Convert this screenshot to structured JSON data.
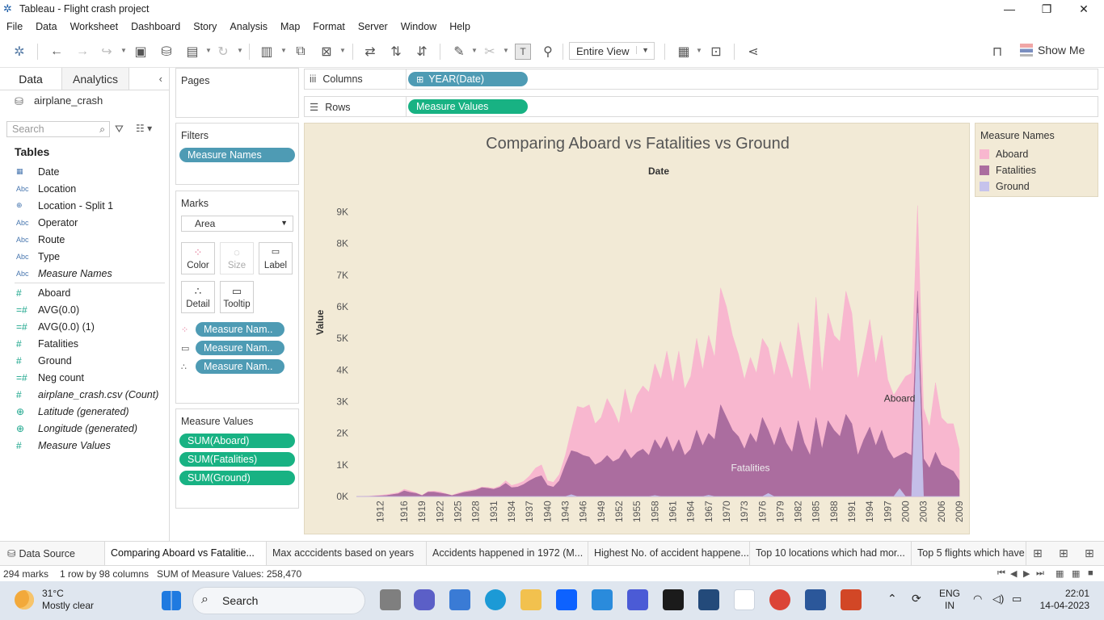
{
  "window": {
    "title": "Tableau - Flight crash project"
  },
  "menu": [
    "File",
    "Data",
    "Worksheet",
    "Dashboard",
    "Story",
    "Analysis",
    "Map",
    "Format",
    "Server",
    "Window",
    "Help"
  ],
  "toolbar": {
    "view_select": "Entire View",
    "show_me": "Show Me"
  },
  "data_pane": {
    "tab_data": "Data",
    "tab_analytics": "Analytics",
    "datasource": "airplane_crash",
    "search_placeholder": "Search",
    "tables_heading": "Tables",
    "dimensions": [
      {
        "type": "date",
        "name": "Date"
      },
      {
        "type": "abc",
        "name": "Location"
      },
      {
        "type": "geo",
        "name": "Location - Split 1"
      },
      {
        "type": "abc",
        "name": "Operator"
      },
      {
        "type": "abc",
        "name": "Route"
      },
      {
        "type": "abc",
        "name": "Type"
      },
      {
        "type": "abc",
        "name": "Measure Names",
        "italic": true
      }
    ],
    "measures": [
      {
        "type": "num",
        "name": "Aboard"
      },
      {
        "type": "calc",
        "name": "AVG(0.0)"
      },
      {
        "type": "calc",
        "name": "AVG(0.0) (1)"
      },
      {
        "type": "num",
        "name": "Fatalities"
      },
      {
        "type": "num",
        "name": "Ground"
      },
      {
        "type": "calc",
        "name": "Neg count"
      },
      {
        "type": "num",
        "name": "airplane_crash.csv (Count)",
        "italic": true
      },
      {
        "type": "geo",
        "name": "Latitude (generated)",
        "italic": true
      },
      {
        "type": "geo",
        "name": "Longitude (generated)",
        "italic": true
      },
      {
        "type": "num",
        "name": "Measure Values",
        "italic": true
      }
    ]
  },
  "cards": {
    "pages": "Pages",
    "filters": "Filters",
    "filter_pill": "Measure Names",
    "marks": "Marks",
    "mark_type": "Area",
    "mark_buttons": [
      "Color",
      "Size",
      "Label",
      "Detail",
      "Tooltip"
    ],
    "mark_pills": [
      "Measure Nam..",
      "Measure Nam..",
      "Measure Nam.."
    ],
    "measure_values": "Measure Values",
    "measure_value_pills": [
      "SUM(Aboard)",
      "SUM(Fatalities)",
      "SUM(Ground)"
    ]
  },
  "shelves": {
    "columns_label": "Columns",
    "columns_pill": "YEAR(Date)",
    "rows_label": "Rows",
    "rows_pill": "Measure Values"
  },
  "colors": {
    "aboard": "#f8b7cf",
    "fatalities": "#ab6d9f",
    "ground": "#c6c3ec",
    "pill_blue": "#4e9bb4",
    "pill_green": "#18b283",
    "viz_bg": "#f2ead6"
  },
  "chart_data": {
    "type": "area",
    "title": "Comparing Aboard vs Fatalities vs Ground",
    "xlabel": "Date",
    "ylabel": "Value",
    "ylim": [
      0,
      9500
    ],
    "y_ticks": [
      "0K",
      "1K",
      "2K",
      "3K",
      "4K",
      "5K",
      "6K",
      "7K",
      "8K",
      "9K"
    ],
    "x_tick_labels": [
      1912,
      1916,
      1919,
      1922,
      1925,
      1928,
      1931,
      1934,
      1937,
      1940,
      1943,
      1946,
      1949,
      1952,
      1955,
      1958,
      1961,
      1964,
      1967,
      1970,
      1973,
      1976,
      1979,
      1982,
      1985,
      1988,
      1991,
      1994,
      1997,
      2000,
      2003,
      2006,
      2009
    ],
    "annotations": [
      "Aboard",
      "Fatalities"
    ],
    "x": [
      1908,
      1910,
      1912,
      1913,
      1915,
      1916,
      1917,
      1918,
      1919,
      1920,
      1921,
      1922,
      1923,
      1924,
      1925,
      1926,
      1927,
      1928,
      1929,
      1930,
      1931,
      1932,
      1933,
      1934,
      1935,
      1936,
      1937,
      1938,
      1939,
      1940,
      1941,
      1942,
      1943,
      1944,
      1945,
      1946,
      1947,
      1948,
      1949,
      1950,
      1951,
      1952,
      1953,
      1954,
      1955,
      1956,
      1957,
      1958,
      1959,
      1960,
      1961,
      1962,
      1963,
      1964,
      1965,
      1966,
      1967,
      1968,
      1969,
      1970,
      1971,
      1972,
      1973,
      1974,
      1975,
      1976,
      1977,
      1978,
      1979,
      1980,
      1981,
      1982,
      1983,
      1984,
      1985,
      1986,
      1987,
      1988,
      1989,
      1990,
      1991,
      1992,
      1993,
      1994,
      1995,
      1996,
      1997,
      1998,
      1999,
      2000,
      2001,
      2002,
      2003,
      2004,
      2005,
      2006,
      2007,
      2008,
      2009
    ],
    "series": [
      {
        "name": "Aboard",
        "values": [
          2,
          10,
          40,
          60,
          120,
          230,
          180,
          120,
          40,
          160,
          170,
          150,
          90,
          40,
          110,
          160,
          200,
          230,
          300,
          290,
          260,
          330,
          500,
          350,
          400,
          480,
          650,
          900,
          1000,
          500,
          450,
          700,
          1300,
          2100,
          2850,
          2800,
          2900,
          2300,
          2500,
          3100,
          2750,
          2300,
          3400,
          2600,
          3200,
          3500,
          3300,
          4200,
          3700,
          4600,
          3600,
          4600,
          3400,
          3800,
          5000,
          4000,
          5100,
          4400,
          6600,
          6000,
          5100,
          4500,
          3700,
          4400,
          3900,
          5000,
          4700,
          3800,
          4900,
          4300,
          3700,
          5500,
          4300,
          3300,
          6300,
          3900,
          5800,
          5100,
          4900,
          6500,
          5800,
          3700,
          4600,
          5600,
          4200,
          5100,
          3700,
          3200,
          3500,
          3800,
          3900,
          9200,
          2800,
          2200,
          3600,
          2500,
          2300,
          2300,
          1500
        ]
      },
      {
        "name": "Fatalities",
        "values": [
          1,
          5,
          20,
          30,
          90,
          180,
          130,
          100,
          30,
          140,
          140,
          110,
          80,
          30,
          80,
          130,
          160,
          200,
          280,
          260,
          230,
          290,
          420,
          280,
          300,
          380,
          500,
          600,
          660,
          350,
          300,
          500,
          1000,
          1450,
          1400,
          1300,
          1250,
          1000,
          1100,
          1300,
          1100,
          1200,
          1500,
          1200,
          1400,
          1500,
          1300,
          1800,
          1500,
          1900,
          1400,
          1800,
          1300,
          1500,
          2100,
          1600,
          2000,
          1800,
          2900,
          2500,
          2100,
          1900,
          1500,
          2000,
          1700,
          2500,
          2100,
          1600,
          2200,
          1700,
          1400,
          2400,
          1700,
          1300,
          2500,
          1500,
          2400,
          2100,
          1900,
          2600,
          2300,
          1300,
          1800,
          2200,
          1600,
          2100,
          1500,
          1200,
          1300,
          1400,
          1300,
          6500,
          1200,
          900,
          1400,
          1000,
          900,
          800,
          500
        ]
      },
      {
        "name": "Ground",
        "values": [
          0,
          0,
          0,
          0,
          0,
          0,
          0,
          0,
          0,
          0,
          0,
          0,
          0,
          0,
          0,
          0,
          0,
          0,
          0,
          0,
          0,
          0,
          0,
          0,
          0,
          0,
          0,
          0,
          0,
          0,
          0,
          0,
          0,
          60,
          0,
          0,
          0,
          0,
          0,
          0,
          0,
          0,
          0,
          0,
          0,
          0,
          0,
          30,
          0,
          0,
          0,
          0,
          0,
          0,
          0,
          0,
          40,
          0,
          0,
          0,
          0,
          0,
          0,
          0,
          0,
          0,
          100,
          0,
          0,
          0,
          0,
          0,
          0,
          0,
          0,
          0,
          0,
          0,
          0,
          0,
          0,
          0,
          0,
          0,
          0,
          0,
          0,
          0,
          250,
          0,
          0,
          5800,
          0,
          0,
          0,
          0,
          0,
          0,
          0
        ]
      }
    ]
  },
  "legend": {
    "title": "Measure Names",
    "items": [
      {
        "label": "Aboard",
        "color": "#f8b7cf"
      },
      {
        "label": "Fatalities",
        "color": "#ab6d9f"
      },
      {
        "label": "Ground",
        "color": "#c6c3ec"
      }
    ]
  },
  "sheet_tabs": [
    "Data Source",
    "Comparing Aboard vs Fatalitie...",
    "Max acccidents based on years",
    "Accidents happened in 1972  (M...",
    "Highest No. of accident happene...",
    "Top 10 locations which had mor...",
    "Top 5 flights which have"
  ],
  "status": {
    "marks": "294 marks",
    "rows_cols": "1 row by 98 columns",
    "sum": "SUM of Measure Values: 258,470"
  },
  "taskbar": {
    "temp": "31°C",
    "weather": "Mostly clear",
    "search": "Search",
    "lang_top": "ENG",
    "lang_bottom": "IN",
    "time": "22:01",
    "date": "14-04-2023"
  }
}
